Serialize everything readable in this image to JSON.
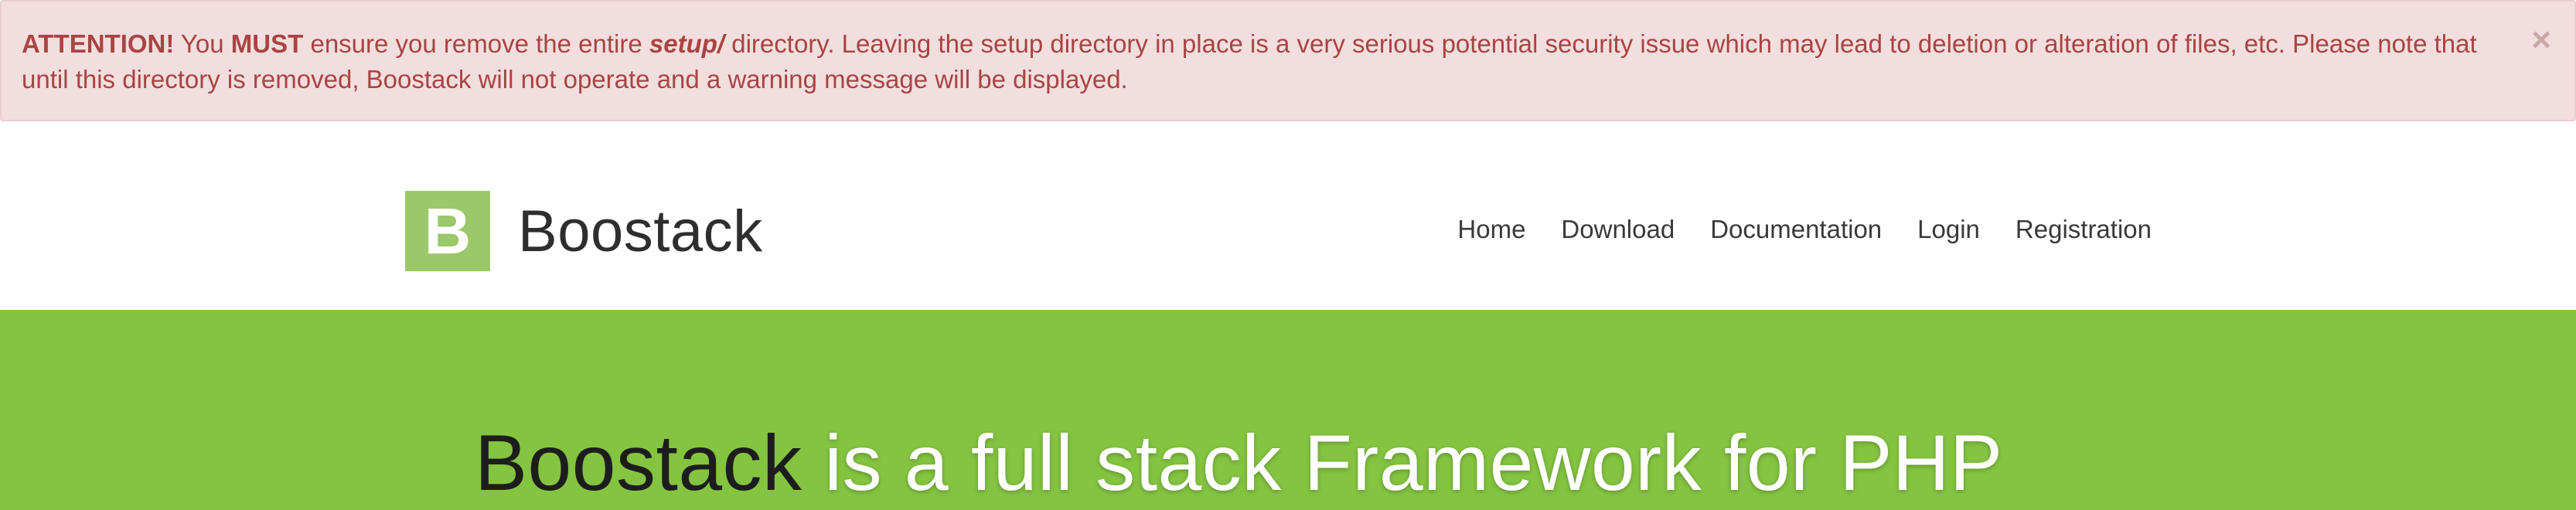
{
  "alert": {
    "attention_label": "ATTENTION!",
    "text_you": " You ",
    "must": "MUST",
    "text_ensure": " ensure you remove the entire ",
    "setup_dir": "setup/",
    "text_rest": " directory. Leaving the setup directory in place is a very serious potential security issue which may lead to deletion or alteration of files, etc. Please note that until this directory is removed, Boostack will not operate and a warning message will be displayed.",
    "close_symbol": "×"
  },
  "navbar": {
    "logo_letter": "B",
    "brand_name": "Boostack",
    "logo_color": "#9bc86a",
    "items": [
      {
        "label": "Home"
      },
      {
        "label": "Download"
      },
      {
        "label": "Documentation"
      },
      {
        "label": "Login"
      },
      {
        "label": "Registration"
      }
    ]
  },
  "hero": {
    "title_brand": "Boostack",
    "title_rest": " is a full stack Framework for PHP",
    "background_color": "#84c441"
  }
}
